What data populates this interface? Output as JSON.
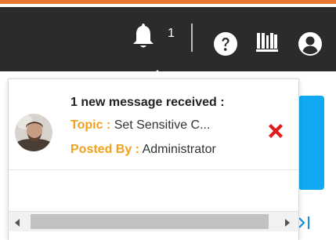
{
  "header": {
    "notification_count": "1",
    "icons": [
      "bell-icon",
      "help-icon",
      "library-icon",
      "user-icon"
    ]
  },
  "notification": {
    "title": "1 new message received :",
    "topic_label": "Topic :",
    "topic_value": "Set Sensitive C...",
    "posted_by_label": "Posted By :",
    "posted_by_value": "Administrator"
  },
  "colors": {
    "accent_orange": "#e8772e",
    "header_bg": "#2b2b2b",
    "label_orange": "#f3a11b",
    "dismiss_red": "#e01b1b",
    "side_panel_blue": "#10a9f2"
  }
}
